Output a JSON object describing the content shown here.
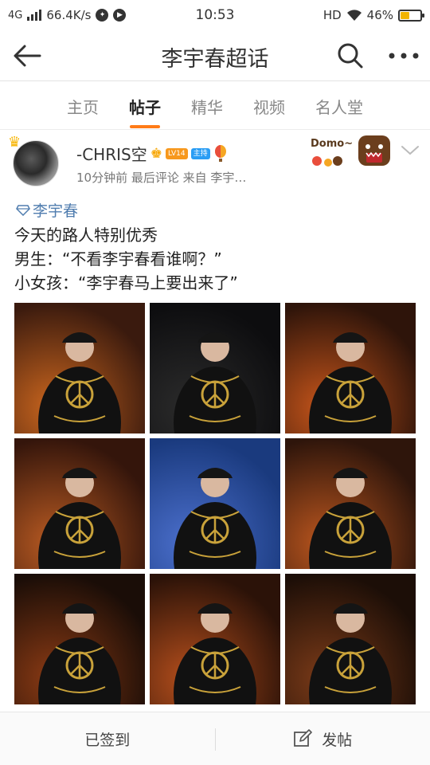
{
  "status_bar": {
    "network": "4G",
    "speed": "66.4K/s",
    "time": "10:53",
    "hd": "HD",
    "battery_percent": "46%",
    "battery_level": 0.46
  },
  "header": {
    "title": "李宇春超话"
  },
  "tabs": [
    {
      "label": "主页",
      "active": false
    },
    {
      "label": "帖子",
      "active": true
    },
    {
      "label": "精华",
      "active": false
    },
    {
      "label": "视频",
      "active": false
    },
    {
      "label": "名人堂",
      "active": false
    }
  ],
  "post": {
    "username": "-CHRIS空",
    "level_badge": "LV14",
    "host_badge": "主持",
    "meta": "10分钟前 最后评论  来自 李宇…",
    "domo_text": "Domo~",
    "topic": "李宇春",
    "lines": [
      "今天的路人特别优秀",
      "男生：“不看李宇春看谁啊？”",
      "小女孩：“李宇春马上要出来了”"
    ]
  },
  "photos": [
    {
      "bg": "#3a1a0e",
      "glow": "#c9651e"
    },
    {
      "bg": "#0d0d0f",
      "glow": "#2b2b2b"
    },
    {
      "bg": "#2e140a",
      "glow": "#c4541a"
    },
    {
      "bg": "#34150b",
      "glow": "#b85a22"
    },
    {
      "bg": "#1a3a7e",
      "glow": "#4b6fcc"
    },
    {
      "bg": "#2e150b",
      "glow": "#b9551e"
    },
    {
      "bg": "#1a0d07",
      "glow": "#8a3a14"
    },
    {
      "bg": "#2b1208",
      "glow": "#b44e1c"
    },
    {
      "bg": "#1c0e07",
      "glow": "#7a3a18"
    }
  ],
  "bottom_bar": {
    "signed_label": "已签到",
    "post_label": "发帖"
  }
}
